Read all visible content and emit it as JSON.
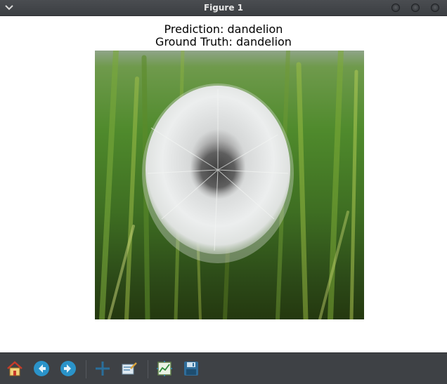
{
  "window": {
    "title": "Figure 1",
    "icons": [
      "chevron-down-icon",
      "window-button",
      "window-button",
      "window-button"
    ]
  },
  "figure": {
    "title_line1": "Prediction: dandelion",
    "title_line2": "Ground Truth: dandelion",
    "image_subject": "dandelion seed head in grass"
  },
  "toolbar": {
    "buttons": [
      {
        "name": "home",
        "icon": "home-icon"
      },
      {
        "name": "back",
        "icon": "back-arrow-icon"
      },
      {
        "name": "forward",
        "icon": "forward-arrow-icon"
      },
      {
        "name": "pan",
        "icon": "pan-move-icon"
      },
      {
        "name": "zoom",
        "icon": "zoom-rect-icon"
      },
      {
        "name": "configure-subplots",
        "icon": "subplots-icon"
      },
      {
        "name": "save",
        "icon": "save-icon"
      }
    ]
  },
  "colors": {
    "titlebar": "#3b3e42",
    "toolbar": "#3e4145",
    "accent_blue": "#2a93c9"
  }
}
